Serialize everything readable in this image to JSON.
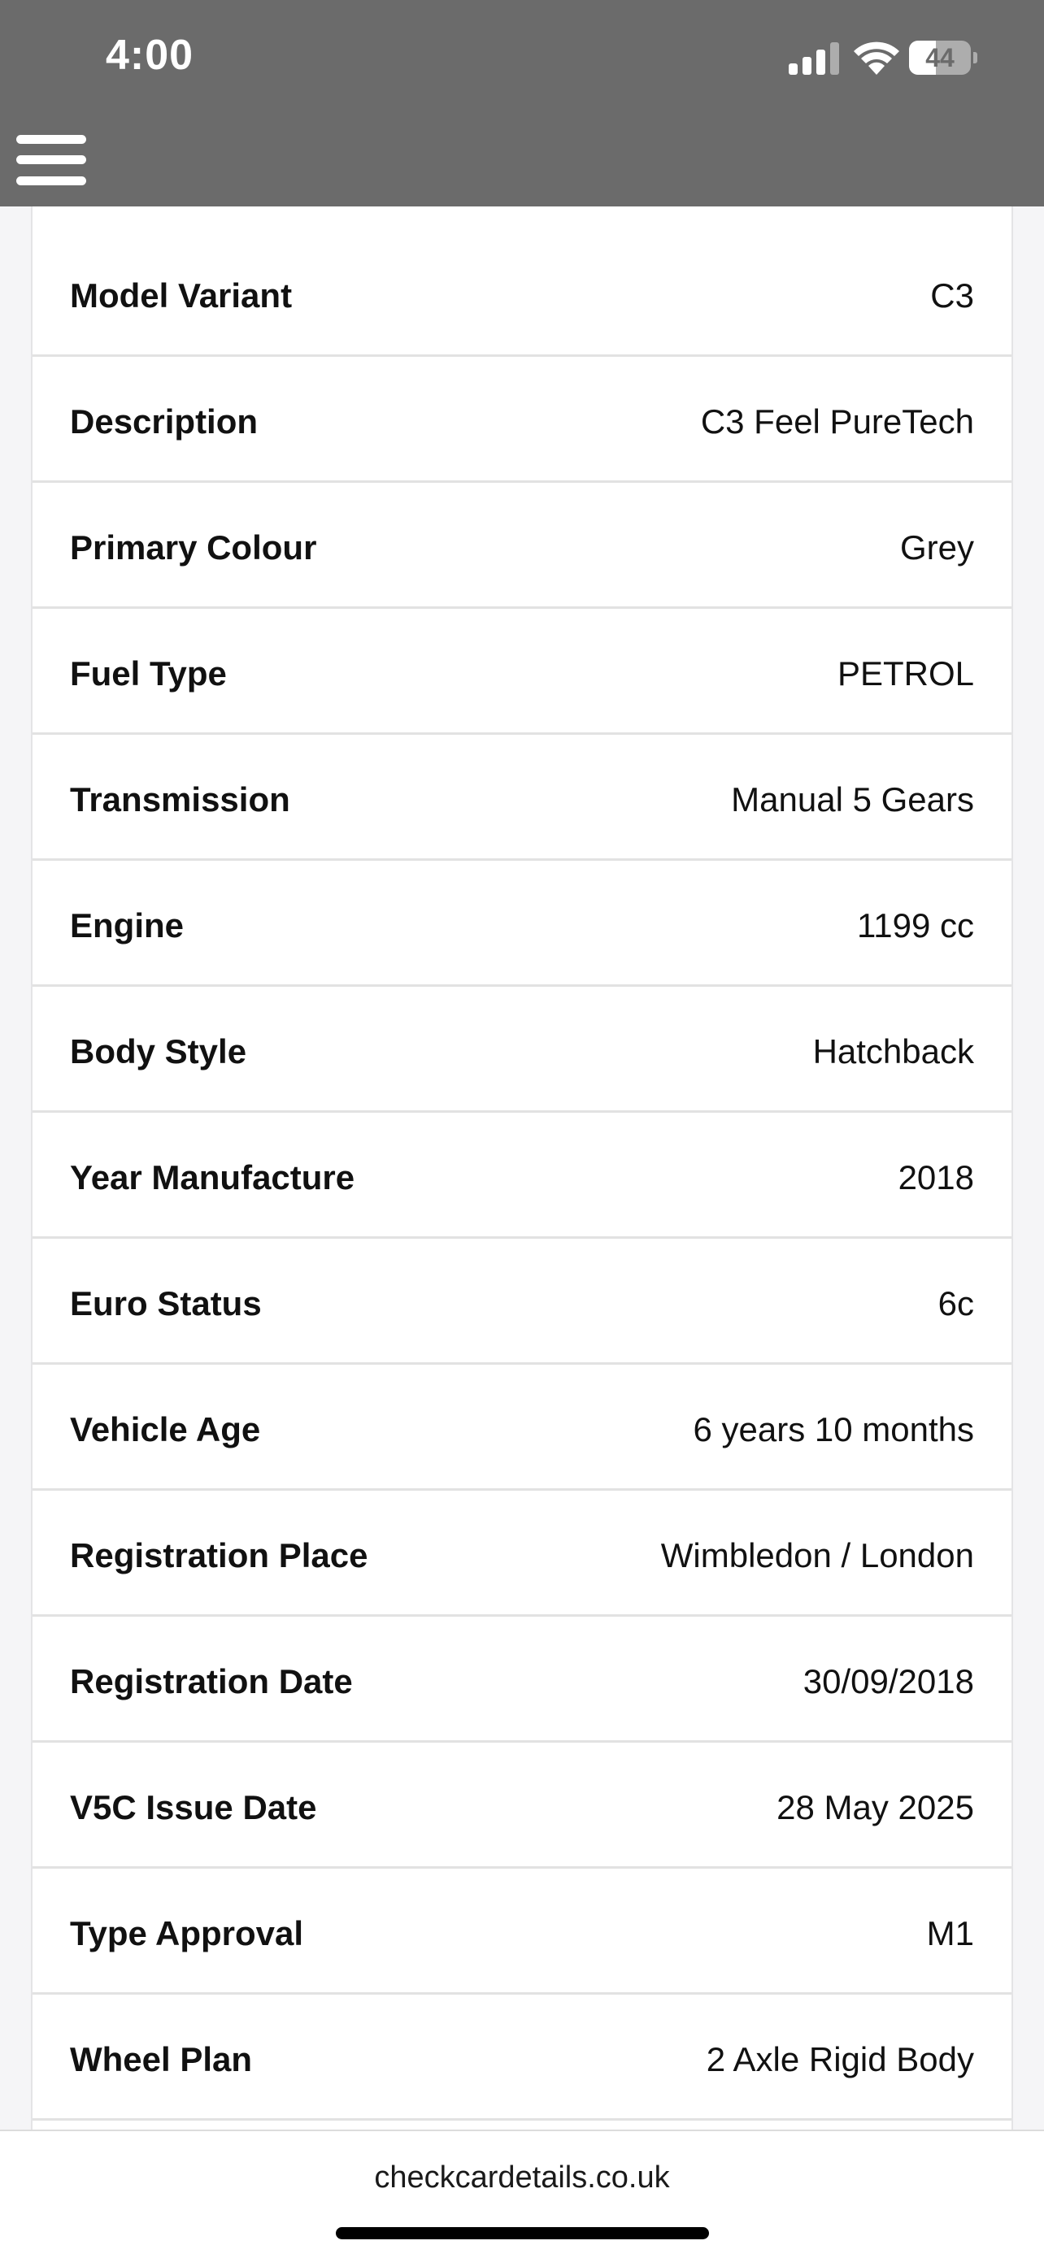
{
  "status_bar": {
    "time": "4:00",
    "battery_level": "44",
    "battery_fraction": 0.44,
    "icons": [
      "signal-icon",
      "wifi-icon",
      "battery-icon"
    ]
  },
  "nav": {
    "menu_icon": "hamburger-menu-icon"
  },
  "details": [
    {
      "label": "Model Variant",
      "value": "C3"
    },
    {
      "label": "Description",
      "value": "C3 Feel PureTech"
    },
    {
      "label": "Primary Colour",
      "value": "Grey"
    },
    {
      "label": "Fuel Type",
      "value": "PETROL"
    },
    {
      "label": "Transmission",
      "value": "Manual 5 Gears"
    },
    {
      "label": "Engine",
      "value": "1199 cc"
    },
    {
      "label": "Body Style",
      "value": "Hatchback"
    },
    {
      "label": "Year Manufacture",
      "value": "2018"
    },
    {
      "label": "Euro Status",
      "value": "6c"
    },
    {
      "label": "Vehicle Age",
      "value": "6 years 10 months"
    },
    {
      "label": "Registration Place",
      "value": "Wimbledon / London"
    },
    {
      "label": "Registration Date",
      "value": "30/09/2018"
    },
    {
      "label": "V5C Issue Date",
      "value": "28 May 2025"
    },
    {
      "label": "Type Approval",
      "value": "M1"
    },
    {
      "label": "Wheel Plan",
      "value": "2 Axle Rigid Body"
    }
  ],
  "browser": {
    "url": "checkcardetails.co.uk"
  },
  "colors": {
    "header_bg": "#6b6b6b",
    "page_bg": "#f5f5f7",
    "card_bg": "#ffffff",
    "divider": "#e2e2e2"
  }
}
